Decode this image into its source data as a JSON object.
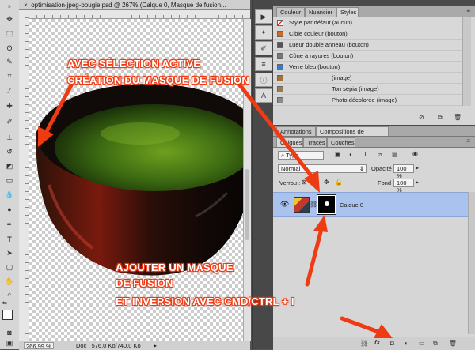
{
  "document": {
    "tab_title": "optimisation-jpeg-bougie.psd @ 267% (Calque 0, Masque de fusion...",
    "close_glyph": "×",
    "zoom": "266,99 %",
    "doc_info": "Doc : 576,0 Ko/740,0 Ko"
  },
  "styles_panel": {
    "tabs": [
      "Couleur",
      "Nuancier",
      "Styles"
    ],
    "active_tab": "Styles",
    "items": [
      {
        "label": "Style par défaut (aucun)",
        "color": "#ffffff"
      },
      {
        "label": "Cible couleur (bouton)",
        "color": "#d2691e"
      },
      {
        "label": "Lueur double anneau (bouton)",
        "color": "#555555"
      },
      {
        "label": "Cône à rayures (bouton)",
        "color": "#777777"
      },
      {
        "label": "Verre bleu (bouton)",
        "color": "#3a78c8"
      },
      {
        "label": "(image)",
        "color": "#a07040"
      },
      {
        "label": "Ton sépia (image)",
        "color": "#9a7a50"
      },
      {
        "label": "Photo décolorée (image)",
        "color": "#8a8a8a"
      }
    ]
  },
  "compositions_tabs": [
    "Annotations",
    "Compositions de calques"
  ],
  "layers_panel": {
    "tabs": [
      "Calques",
      "Tracés",
      "Couches"
    ],
    "filter_kind": "Type",
    "blend_mode": "Normal",
    "opacity_label": "Opacité :",
    "opacity_value": "100 %",
    "lock_label": "Verrou :",
    "fill_label": "Fond :",
    "fill_value": "100 %",
    "layer_name": "Calque 0"
  },
  "annotations": {
    "top_line1": "AVEC SÉLECTION ACTIVE",
    "top_line2": "CRÉATION DU MASQUE DE FUSION",
    "bottom_line1": "AJOUTER UN MASQUE",
    "bottom_line2": "DE FUSION",
    "bottom_line3": "ET INVERSION  AVEC CMD/CTRL + I"
  },
  "colors": {
    "annotation_red": "#ee3b14",
    "layer_selected": "#a9c3ee"
  }
}
